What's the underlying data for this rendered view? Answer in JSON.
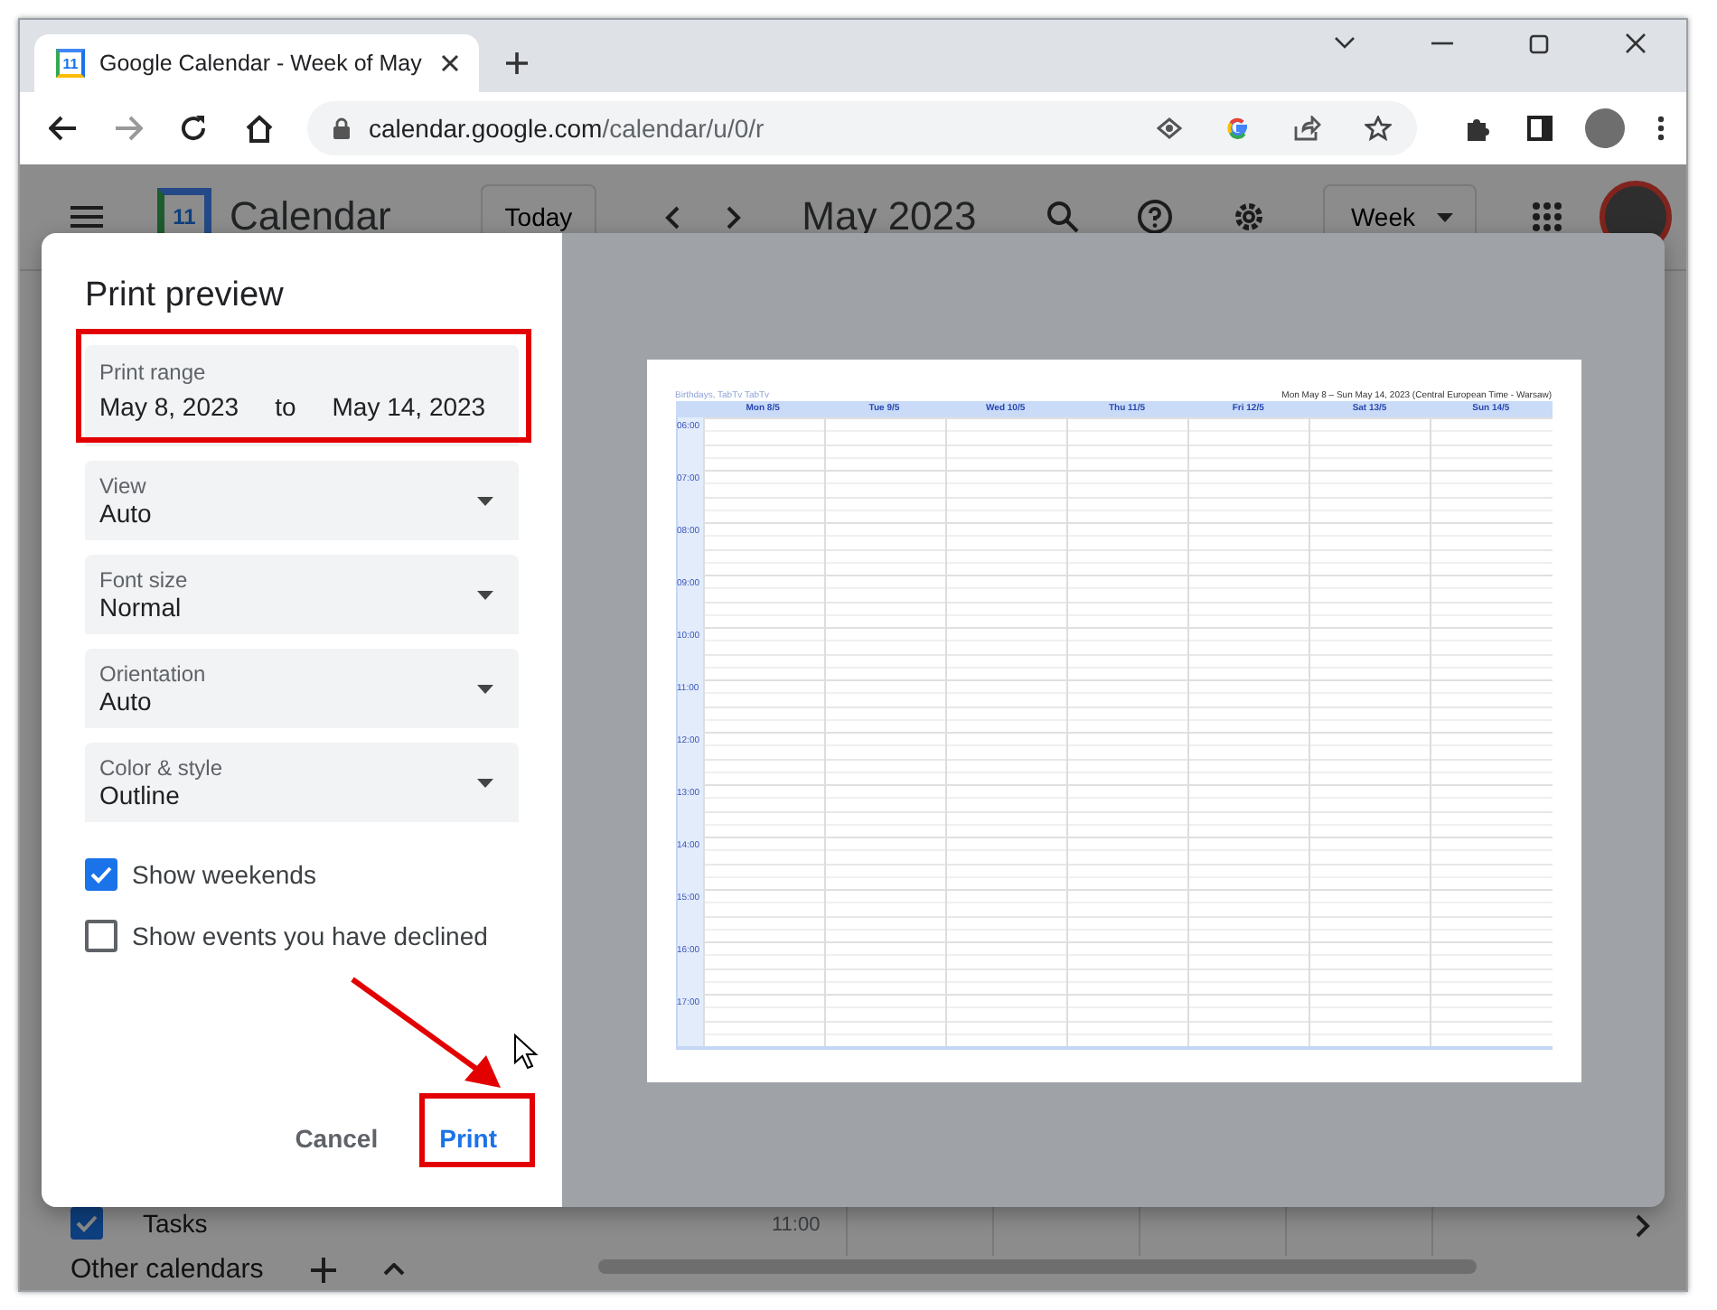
{
  "browser": {
    "tab_title": "Google Calendar - Week of May",
    "favicon_text": "11",
    "url_host": "calendar.google.com",
    "url_path": "/calendar/u/0/r"
  },
  "app": {
    "logo_text": "11",
    "title": "Calendar",
    "today_button": "Today",
    "month": "May 2023",
    "view": "Week",
    "tasks": {
      "label": "Tasks",
      "checked": true
    },
    "other_calendars": "Other calendars",
    "time_label": "11:00"
  },
  "dialog": {
    "title": "Print preview",
    "print_range": {
      "label": "Print range",
      "start": "May 8, 2023",
      "separator": "to",
      "end": "May 14, 2023"
    },
    "selects": [
      {
        "label": "View",
        "value": "Auto"
      },
      {
        "label": "Font size",
        "value": "Normal"
      },
      {
        "label": "Orientation",
        "value": "Auto"
      },
      {
        "label": "Color & style",
        "value": "Outline"
      }
    ],
    "checkboxes": [
      {
        "label": "Show weekends",
        "checked": true
      },
      {
        "label": "Show events you have declined",
        "checked": false
      }
    ],
    "cancel_button": "Cancel",
    "print_button": "Print"
  },
  "preview": {
    "header_left": "Birthdays, TabTv TabTv",
    "header_right": "Mon May 8 – Sun May 14, 2023 (Central European Time - Warsaw)",
    "days": [
      "Mon 8/5",
      "Tue 9/5",
      "Wed 10/5",
      "Thu 11/5",
      "Fri 12/5",
      "Sat 13/5",
      "Sun 14/5"
    ],
    "hours": [
      "06:00",
      "07:00",
      "08:00",
      "09:00",
      "10:00",
      "11:00",
      "12:00",
      "13:00",
      "14:00",
      "15:00",
      "16:00",
      "17:00"
    ]
  }
}
